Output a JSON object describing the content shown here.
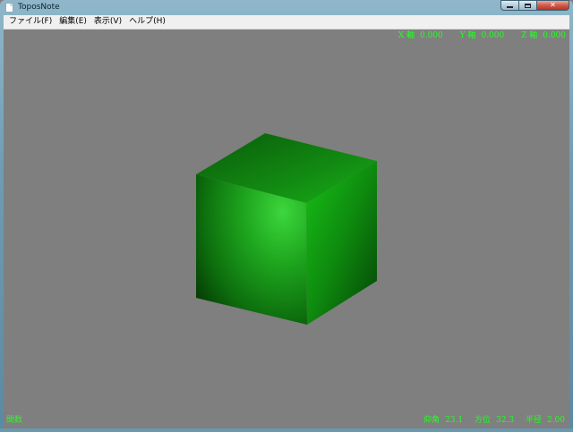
{
  "window": {
    "title": "ToposNote"
  },
  "menu": [
    "ファイル(F)",
    "編集(E)",
    "表示(V)",
    "ヘルプ(H)"
  ],
  "axes": {
    "x_label": "X 軸",
    "x_value": "0.000",
    "y_label": "Y 軸",
    "y_value": "0.000",
    "z_label": "Z 軸",
    "z_value": "0.000"
  },
  "status": {
    "left": "関数",
    "elevation_label": "仰角",
    "elevation_value": "23.1",
    "azimuth_label": "方位",
    "azimuth_value": "32.3",
    "radius_label": "半径",
    "radius_value": "2.00"
  },
  "colors": {
    "hud": "#22ff22",
    "background": "#7f7f7f",
    "cube": "#1aa81a"
  }
}
